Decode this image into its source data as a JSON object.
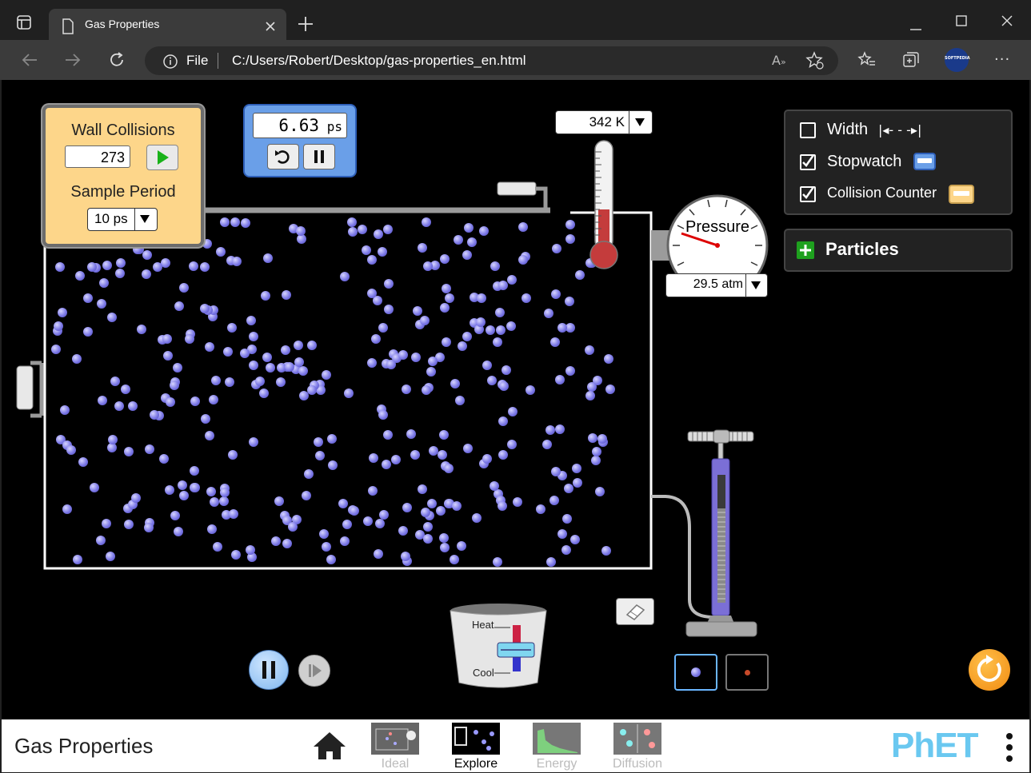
{
  "browser": {
    "tab_title": "Gas Properties",
    "url_scheme": "File",
    "url": "C:/Users/Robert/Desktop/gas-properties_en.html",
    "profile_badge": "SOFTPEDIA"
  },
  "wall_collisions": {
    "title": "Wall Collisions",
    "count": "273",
    "sample_period_label": "Sample Period",
    "sample_period": "10 ps"
  },
  "stopwatch": {
    "time_value": "6.63",
    "time_unit": "ps"
  },
  "thermometer": {
    "reading": "342 K"
  },
  "pressure_gauge": {
    "label": "Pressure",
    "reading": "29.5 atm"
  },
  "options_panel": {
    "width_label": "Width",
    "width_checked": false,
    "stopwatch_label": "Stopwatch",
    "stopwatch_checked": true,
    "collision_counter_label": "Collision Counter",
    "collision_counter_checked": true
  },
  "particles_panel": {
    "label": "Particles"
  },
  "heater": {
    "heat_label": "Heat",
    "cool_label": "Cool"
  },
  "navbar": {
    "sim_title": "Gas Properties",
    "screens": [
      {
        "label": "Ideal",
        "selected": false
      },
      {
        "label": "Explore",
        "selected": true
      },
      {
        "label": "Energy",
        "selected": false
      },
      {
        "label": "Diffusion",
        "selected": false
      }
    ],
    "brand": "PhET"
  },
  "colors": {
    "panel_orange": "#fdd68a",
    "stopwatch_blue": "#6a9fe8",
    "particle_purple": "#7b78e6",
    "reset_orange": "#f39c1a"
  }
}
